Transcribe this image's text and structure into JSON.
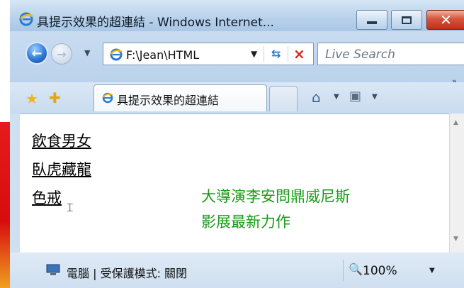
{
  "window": {
    "title": "具提示效果的超連結 - Windows Internet...",
    "buttons": {
      "minimize": "minimize",
      "maximize": "maximize",
      "close": "close"
    }
  },
  "nav": {
    "back_icon": "back-arrow-icon",
    "forward_icon": "forward-arrow-icon",
    "address": "F:\\Jean\\HTML",
    "search_placeholder": "Live Search",
    "refresh_icon": "refresh-icon",
    "stop_icon": "stop-icon"
  },
  "tabs": {
    "active_label": "具提示效果的超連結",
    "home_icon": "home-icon",
    "feeds_icon": "feeds-icon"
  },
  "content": {
    "links": [
      "飲食男女",
      "臥虎藏龍",
      "色戒"
    ],
    "tooltip_lines": [
      "大導演李安問鼎威尼斯",
      "影展最新力作"
    ],
    "tooltip_color": "#1a9a1a"
  },
  "status": {
    "text": "電腦 | 受保護模式: 關閉",
    "zoom": "100%"
  },
  "colors": {
    "tooltip_text": "#1a9a1a",
    "close_button": "#c0301a",
    "title_bar": "#bcd4ec"
  }
}
